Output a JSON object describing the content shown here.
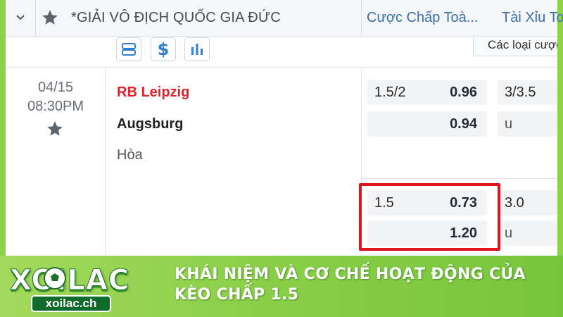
{
  "header": {
    "title": "*GIẢI VÔ ĐỊCH QUỐC GIA ĐỨC",
    "col_handicap": "Cược Chấp Toà...",
    "col_overunder": "Tài Xỉu To"
  },
  "tools": {
    "bet_types_label": "Các loại cược"
  },
  "match": {
    "date": "04/15",
    "time": "08:30PM",
    "home_team": "RB Leipzig",
    "away_team": "Augsburg",
    "draw_label": "Hòa",
    "odds": [
      {
        "handicap": "1.5/2",
        "home_price": "0.96",
        "away_price": "0.94",
        "ou_line": "3/3.5",
        "ou_under_label": "u"
      },
      {
        "handicap": "1.5",
        "home_price": "0.73",
        "away_price": "1.20",
        "ou_line": "3.0",
        "ou_under_label": "u"
      }
    ]
  },
  "banner": {
    "logo_text": "XOILAC",
    "logo_domain": "xoilac.ch",
    "title": "KHÁI NIỆM VÀ CƠ CHẾ HOẠT ĐỘNG CỦA KÈO CHẤP 1.5"
  },
  "colors": {
    "accent_blue": "#3a6fa8",
    "home_red": "#e0202b",
    "highlight_red": "#e0161f",
    "banner_green": "#8bcf49"
  },
  "icons": [
    "chevron-down-icon",
    "star-icon",
    "schedule-icon",
    "dollar-icon",
    "bar-chart-icon",
    "soccer-ball-icon"
  ]
}
